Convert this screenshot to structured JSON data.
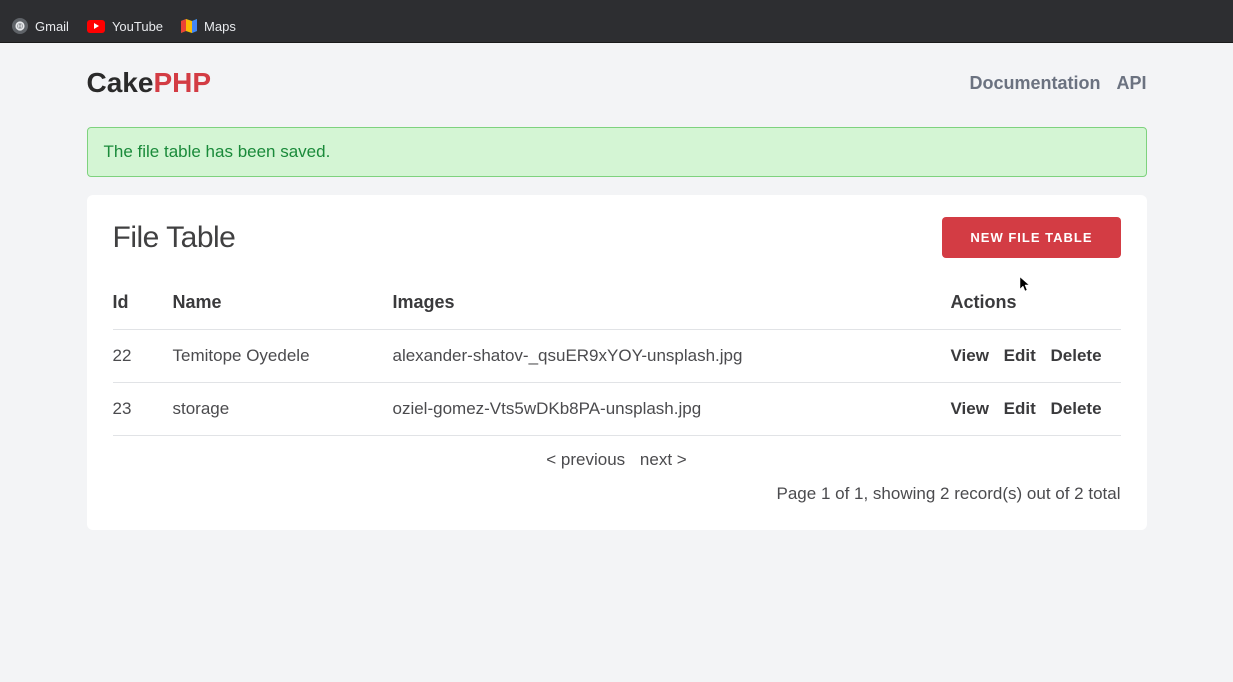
{
  "bookmarks": {
    "gmail": "Gmail",
    "youtube": "YouTube",
    "maps": "Maps"
  },
  "brand": {
    "part1": "Cake",
    "part2": "PHP"
  },
  "nav": {
    "documentation": "Documentation",
    "api": "API"
  },
  "alert": {
    "message": "The file table has been saved."
  },
  "page": {
    "title": "File Table",
    "new_button": "NEW FILE TABLE"
  },
  "table": {
    "headers": {
      "id": "Id",
      "name": "Name",
      "images": "Images",
      "actions": "Actions"
    },
    "rows": [
      {
        "id": "22",
        "name": "Temitope Oyedele",
        "images": "alexander-shatov-_qsuER9xYOY-unsplash.jpg"
      },
      {
        "id": "23",
        "name": "storage",
        "images": "oziel-gomez-Vts5wDKb8PA-unsplash.jpg"
      }
    ],
    "action_labels": {
      "view": "View",
      "edit": "Edit",
      "delete": "Delete"
    }
  },
  "pagination": {
    "previous": "< previous",
    "next": "next >",
    "summary": "Page 1 of 1, showing 2 record(s) out of 2 total"
  }
}
